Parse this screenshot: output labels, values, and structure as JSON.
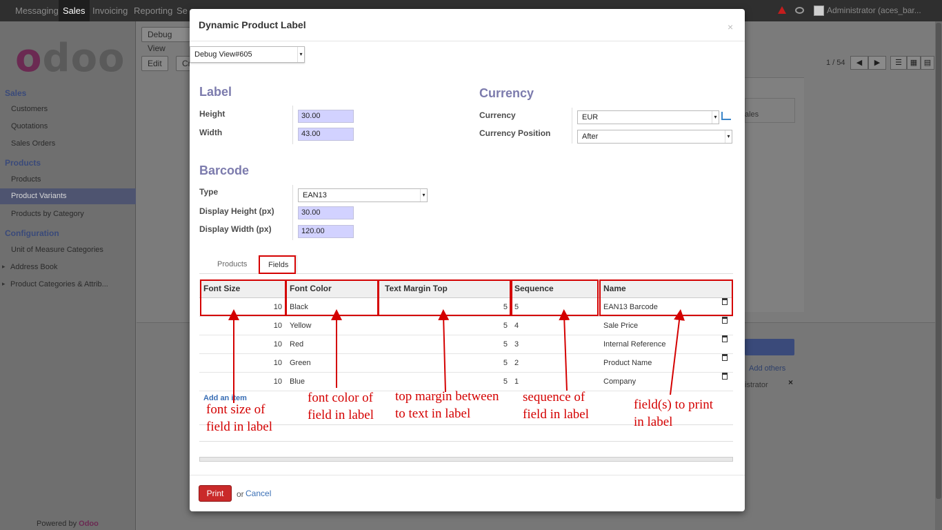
{
  "topbar": {
    "menus": [
      "Messaging",
      "Sales",
      "Invoicing",
      "Reporting",
      "Se"
    ],
    "active_menu": "Sales",
    "user": "Administrator (aces_bar..."
  },
  "sidebar": {
    "logo": "odoo",
    "sections": [
      {
        "title": "Sales",
        "items": [
          "Customers",
          "Quotations",
          "Sales Orders"
        ]
      },
      {
        "title": "Products",
        "items": [
          "Products",
          "Product Variants",
          "Products by Category"
        ]
      },
      {
        "title": "Configuration",
        "items": [
          "Unit of Measure Categories",
          "Address Book",
          "Product Categories & Attrib..."
        ]
      }
    ],
    "active_item": "Product Variants",
    "powered_by": "Powered by",
    "powered_brand": "Odoo"
  },
  "background": {
    "debug_view": "Debug View",
    "edit_button": "Edit",
    "create_button": "Cr",
    "pager": "1 / 54",
    "sales_fragment": "ales",
    "add_others": "Add others",
    "admin_fragment": "istrator",
    "remove_x": "×"
  },
  "modal": {
    "title": "Dynamic Product Label",
    "close": "×",
    "debug_select": "Debug View#605",
    "label_section": {
      "title": "Label",
      "height_label": "Height",
      "height_value": "30.00",
      "width_label": "Width",
      "width_value": "43.00"
    },
    "currency_section": {
      "title": "Currency",
      "currency_label": "Currency",
      "currency_value": "EUR",
      "position_label": "Currency Position",
      "position_value": "After"
    },
    "barcode_section": {
      "title": "Barcode",
      "type_label": "Type",
      "type_value": "EAN13",
      "dheight_label": "Display Height (px)",
      "dheight_value": "30.00",
      "dwidth_label": "Display Width (px)",
      "dwidth_value": "120.00"
    },
    "tabs": [
      "Products",
      "Fields"
    ],
    "active_tab": "Fields",
    "table": {
      "headers": [
        "Font Size",
        "Font Color",
        "Text Margin Top",
        "Sequence",
        "Name"
      ],
      "rows": [
        {
          "font_size": "10",
          "font_color": "Black",
          "margin_top": "5",
          "sequence": "5",
          "name": "EAN13 Barcode"
        },
        {
          "font_size": "10",
          "font_color": "Yellow",
          "margin_top": "5",
          "sequence": "4",
          "name": "Sale Price"
        },
        {
          "font_size": "10",
          "font_color": "Red",
          "margin_top": "5",
          "sequence": "3",
          "name": "Internal Reference"
        },
        {
          "font_size": "10",
          "font_color": "Green",
          "margin_top": "5",
          "sequence": "2",
          "name": "Product Name"
        },
        {
          "font_size": "10",
          "font_color": "Blue",
          "margin_top": "5",
          "sequence": "1",
          "name": "Company"
        }
      ],
      "add_item": "Add an item"
    },
    "footer": {
      "print": "Print",
      "or": "or",
      "cancel": "Cancel"
    }
  },
  "annotations": {
    "font_size": "font size of\nfield in label",
    "font_color": "font color of\nfield in label",
    "margin": "top margin between\nto text in label",
    "sequence": "sequence of\nfield in label",
    "fields": "field(s) to print\nin label"
  },
  "colors": {
    "accent": "#7c7bad",
    "annotation": "#d40000",
    "print_button": "#c92a2a",
    "link": "#3a6fb5",
    "input_bg": "#d2d2ff"
  }
}
